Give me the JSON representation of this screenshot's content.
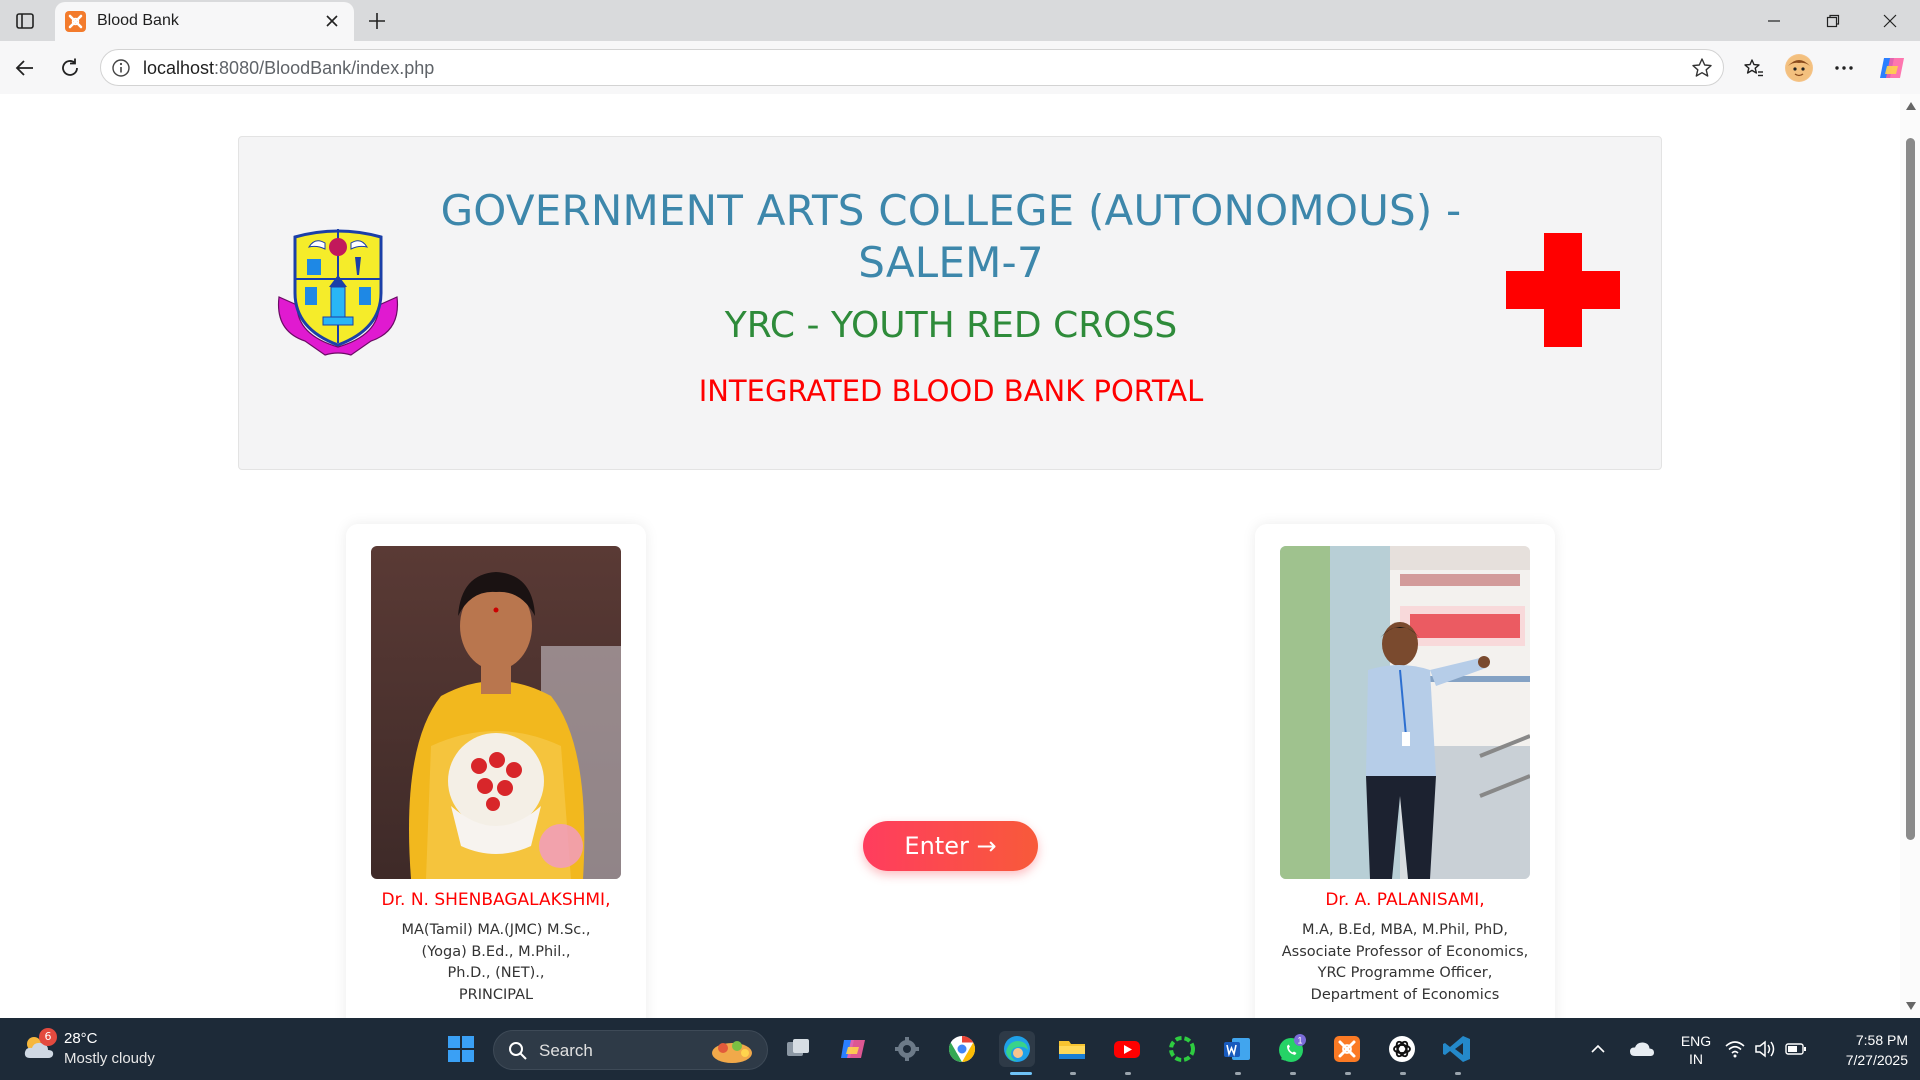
{
  "browser": {
    "tab_title": "Blood Bank",
    "url_host": "localhost",
    "url_path": ":8080/BloodBank/index.php"
  },
  "header": {
    "college_line1": "GOVERNMENT ARTS COLLEGE (AUTONOMOUS) -",
    "college_line2": "SALEM-7",
    "yrc": "YRC - YOUTH RED CROSS",
    "portal": "INTEGRATED BLOOD BANK PORTAL"
  },
  "people": [
    {
      "name": "Dr. N. SHENBAGALAKSHMI,",
      "quals": [
        "MA(Tamil) MA.(JMC) M.Sc.,",
        "(Yoga) B.Ed., M.Phil.,",
        "Ph.D., (NET).,",
        "PRINCIPAL"
      ]
    },
    {
      "name": "Dr. A. PALANISAMI,",
      "quals": [
        "M.A, B.Ed, MBA, M.Phil, PhD,",
        "Associate Professor of Economics,",
        "YRC Programme Officer,",
        "Department of Economics"
      ]
    }
  ],
  "enter_button": "Enter →",
  "taskbar": {
    "weather_temp": "28°C",
    "weather_cond": "Mostly cloudy",
    "weather_badge": "6",
    "search_placeholder": "Search",
    "whatsapp_badge": "1",
    "lang_line1": "ENG",
    "lang_line2": "IN",
    "time": "7:58 PM",
    "date": "7/27/2025"
  },
  "colors": {
    "title_blue": "#3d87ab",
    "yrc_green": "#2e8b3a",
    "portal_red": "#ff0000",
    "enter_gradient_start": "#ff3d5e",
    "enter_gradient_end": "#f85a3a"
  }
}
